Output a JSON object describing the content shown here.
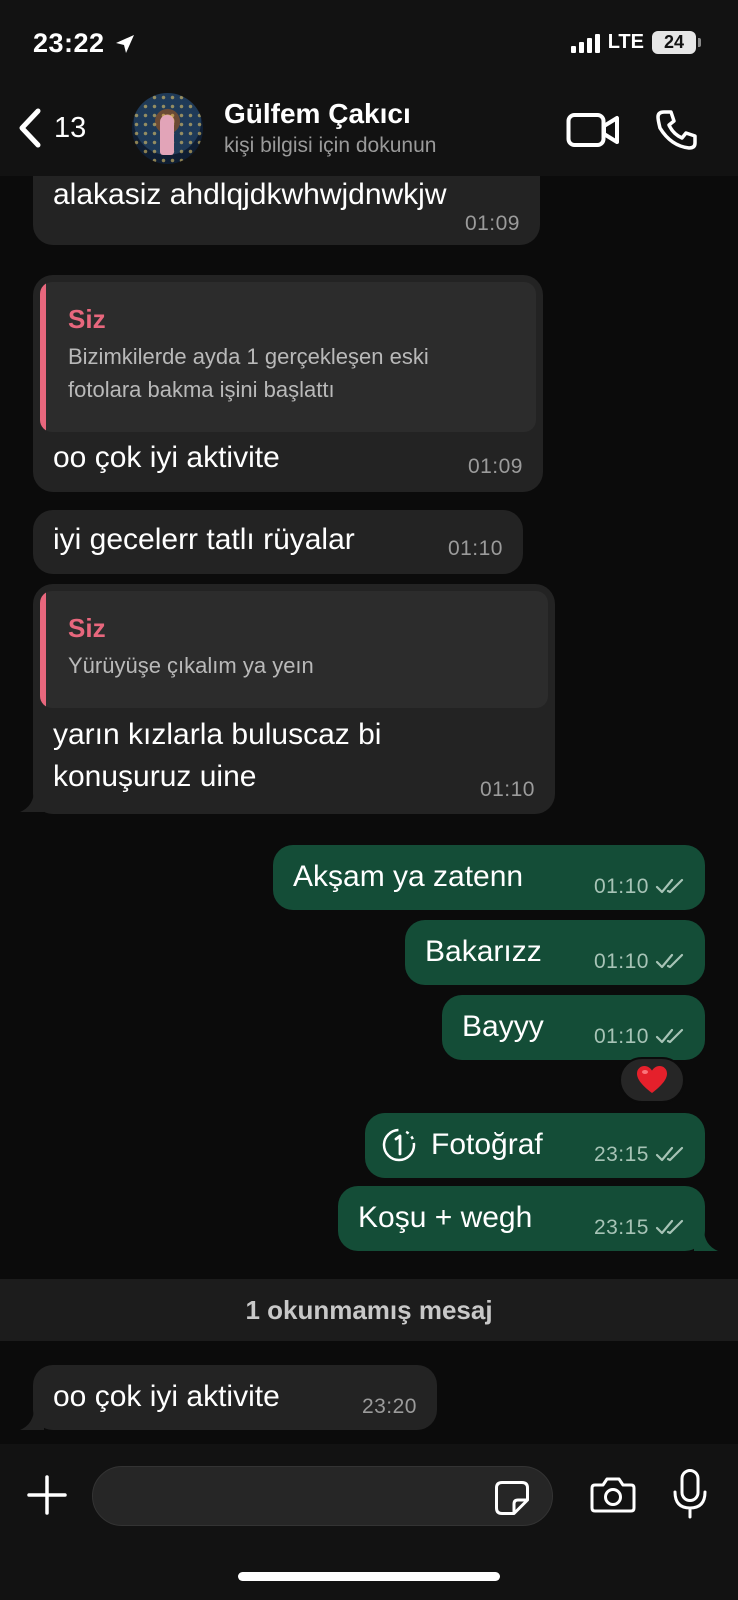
{
  "status_bar": {
    "time": "23:22",
    "network": "LTE",
    "battery": "24"
  },
  "header": {
    "back_count": "13",
    "contact_name": "Gülfem Çakıcı",
    "contact_subtitle": "kişi bilgisi için dokunun"
  },
  "messages": [
    {
      "direction": "in",
      "text": "alakasiz ahdlqjdkwhwjdnwkjw",
      "time": "01:09"
    },
    {
      "direction": "in",
      "quote_author": "Siz",
      "quote_lines": [
        "Bizimkilerde ayda 1 gerçekleşen eski",
        "fotolara bakma işini başlattı"
      ],
      "text": "oo çok iyi aktivite",
      "time": "01:09"
    },
    {
      "direction": "in",
      "text": "iyi gecelerr tatlı rüyalar",
      "time": "01:10"
    },
    {
      "direction": "in",
      "quote_author": "Siz",
      "quote_lines": [
        "Yürüyüşe çıkalım ya yeın"
      ],
      "text_lines": [
        "yarın kızlarla buluscaz bi",
        "konuşuruz uine"
      ],
      "time": "01:10"
    },
    {
      "direction": "out",
      "text": "Akşam ya zatenn",
      "time": "01:10",
      "status": "read"
    },
    {
      "direction": "out",
      "text": "Bakarızz",
      "time": "01:10",
      "status": "read"
    },
    {
      "direction": "out",
      "text": "Bayyy",
      "time": "01:10",
      "status": "read",
      "reaction": "❤️"
    },
    {
      "direction": "out",
      "type": "view-once-photo",
      "text": "Fotoğraf",
      "time": "23:15",
      "status": "read"
    },
    {
      "direction": "out",
      "text": "Koşu + wegh",
      "time": "23:15",
      "status": "read"
    },
    {
      "direction": "in",
      "text": "oo çok iyi aktivite",
      "time": "23:20"
    }
  ],
  "unread_divider": "1 okunmamış mesaj",
  "composer": {
    "placeholder": ""
  },
  "colors": {
    "incoming_bubble": "#232323",
    "outgoing_bubble": "#144d37",
    "quote_accent": "#e8677d",
    "background": "#0b0b0b"
  }
}
